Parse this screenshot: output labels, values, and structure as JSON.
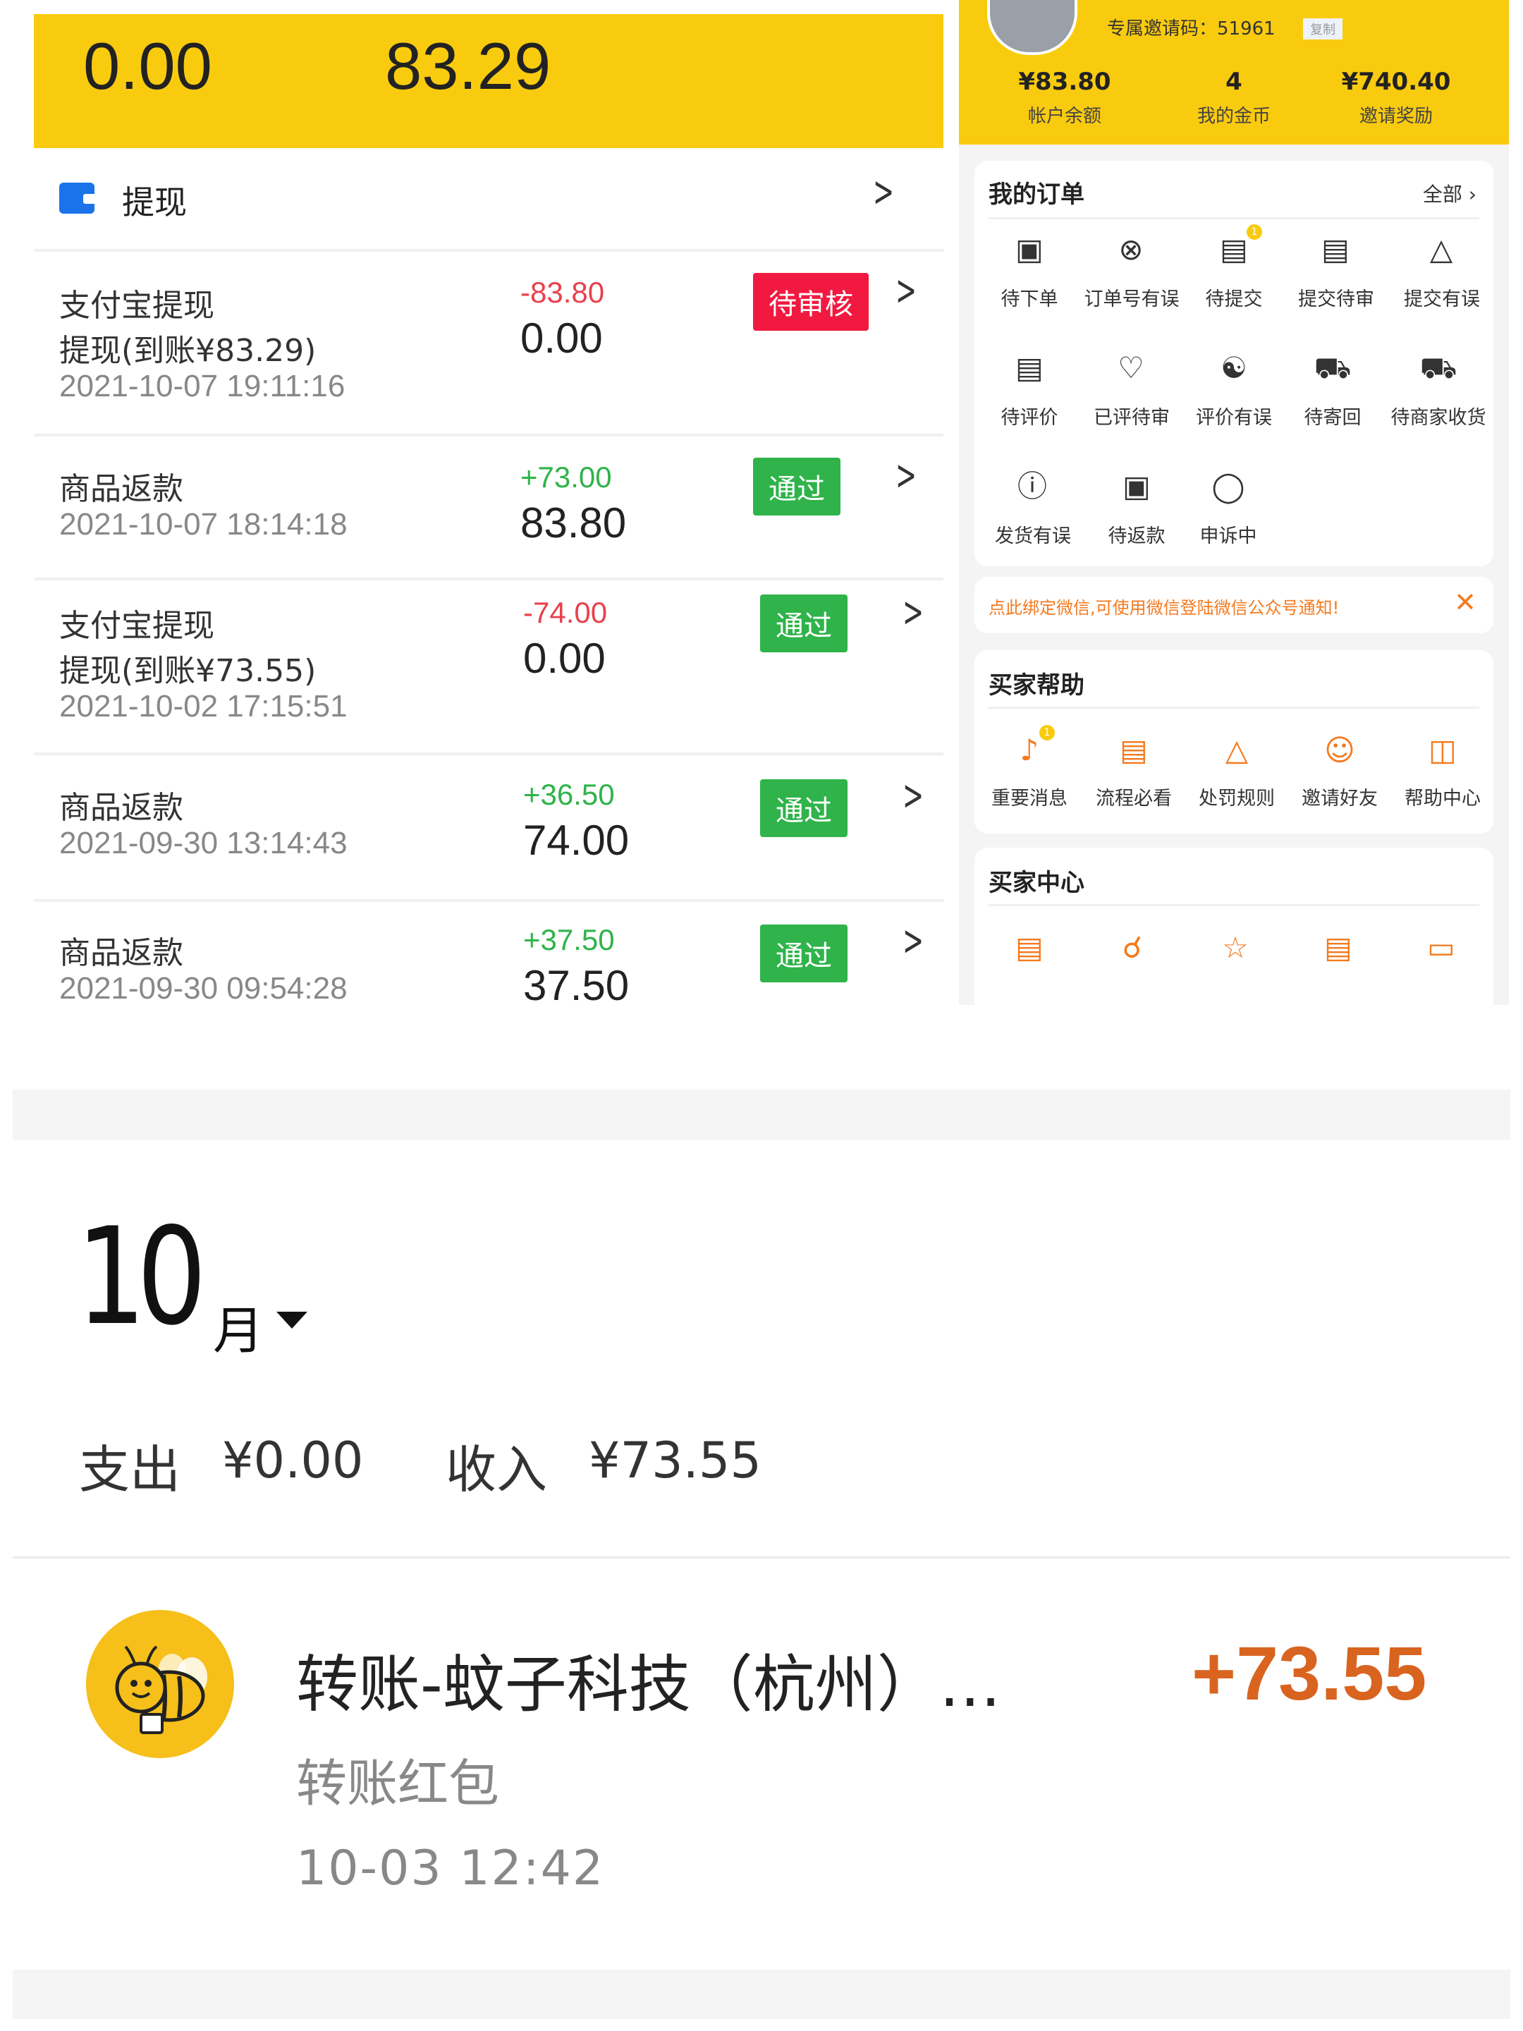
{
  "left": {
    "balance_a": "0.00",
    "balance_b": "83.29",
    "withdraw_title": "提现",
    "records": [
      {
        "title": "支付宝提现",
        "subtitle": "提现(到账¥83.29)",
        "datetime": "2021-10-07 19:11:16",
        "change": "-83.80",
        "balance": "0.00",
        "status": "待审核"
      },
      {
        "title": "商品返款",
        "subtitle": "",
        "datetime": "2021-10-07 18:14:18",
        "change": "+73.00",
        "balance": "83.80",
        "status": "通过"
      },
      {
        "title": "支付宝提现",
        "subtitle": "提现(到账¥73.55)",
        "datetime": "2021-10-02 17:15:51",
        "change": "-74.00",
        "balance": "0.00",
        "status": "通过"
      },
      {
        "title": "商品返款",
        "subtitle": "",
        "datetime": "2021-09-30 13:14:43",
        "change": "+36.50",
        "balance": "74.00",
        "status": "通过"
      },
      {
        "title": "商品返款",
        "subtitle": "",
        "datetime": "2021-09-30 09:54:28",
        "change": "+37.50",
        "balance": "37.50",
        "status": "通过"
      }
    ],
    "colors": {
      "yellow": "#f9cb0f",
      "red": "#f21940",
      "green": "#2fb34a"
    }
  },
  "right": {
    "invite_code": "专属邀请码：51961",
    "invite_tag": "复制",
    "stats": [
      {
        "value": "¥83.80",
        "label": "帐户余额"
      },
      {
        "value": "4",
        "label": "我的金币"
      },
      {
        "value": "¥740.40",
        "label": "邀请奖励"
      }
    ],
    "orders": {
      "title": "我的订单",
      "all": "全部 ›",
      "items": [
        {
          "icon": "wallet-icon",
          "label": "待下单"
        },
        {
          "icon": "circle-x-icon",
          "label": "订单号有误"
        },
        {
          "icon": "message-icon",
          "label": "待提交",
          "badge": "1"
        },
        {
          "icon": "clipboard-icon",
          "label": "提交待审"
        },
        {
          "icon": "warning-icon",
          "label": "提交有误"
        },
        {
          "icon": "comment-icon",
          "label": "待评价"
        },
        {
          "icon": "shield-icon",
          "label": "已评待审"
        },
        {
          "icon": "review-error-icon",
          "label": "评价有误"
        },
        {
          "icon": "truck-icon",
          "label": "待寄回"
        },
        {
          "icon": "truck-icon",
          "label": "待商家收货"
        },
        {
          "icon": "exclamation-icon",
          "label": "发货有误"
        },
        {
          "icon": "wallet-icon",
          "label": "待返款"
        },
        {
          "icon": "chat-icon",
          "label": "申诉中"
        }
      ]
    },
    "notice": {
      "text": "点此绑定微信,可使用微信登陆微信公众号通知!",
      "close": "✕"
    },
    "help": {
      "title": "买家帮助",
      "items": [
        {
          "icon": "speaker-icon",
          "label": "重要消息",
          "badge": "1"
        },
        {
          "icon": "clipboard-icon",
          "label": "流程必看"
        },
        {
          "icon": "warning-icon",
          "label": "处罚规则"
        },
        {
          "icon": "users-icon",
          "label": "邀请好友"
        },
        {
          "icon": "book-icon",
          "label": "帮助中心"
        }
      ]
    },
    "center": {
      "title": "买家中心",
      "items": [
        {
          "icon": "calendar-icon"
        },
        {
          "icon": "award-icon"
        },
        {
          "icon": "star-icon"
        },
        {
          "icon": "note-icon"
        },
        {
          "icon": "card-icon"
        }
      ]
    },
    "accent": "#f47a1f"
  },
  "bill": {
    "month_number": "10",
    "month_unit": "月",
    "expense_label": "支出",
    "expense_value": "¥0.00",
    "income_label": "收入",
    "income_value": "¥73.55",
    "tx_title": "转账-蚊子科技（杭州）…",
    "tx_amount": "+73.55",
    "tx_sub": "转账红包",
    "tx_time": "10-03  12:42",
    "amount_color": "#d96420"
  }
}
